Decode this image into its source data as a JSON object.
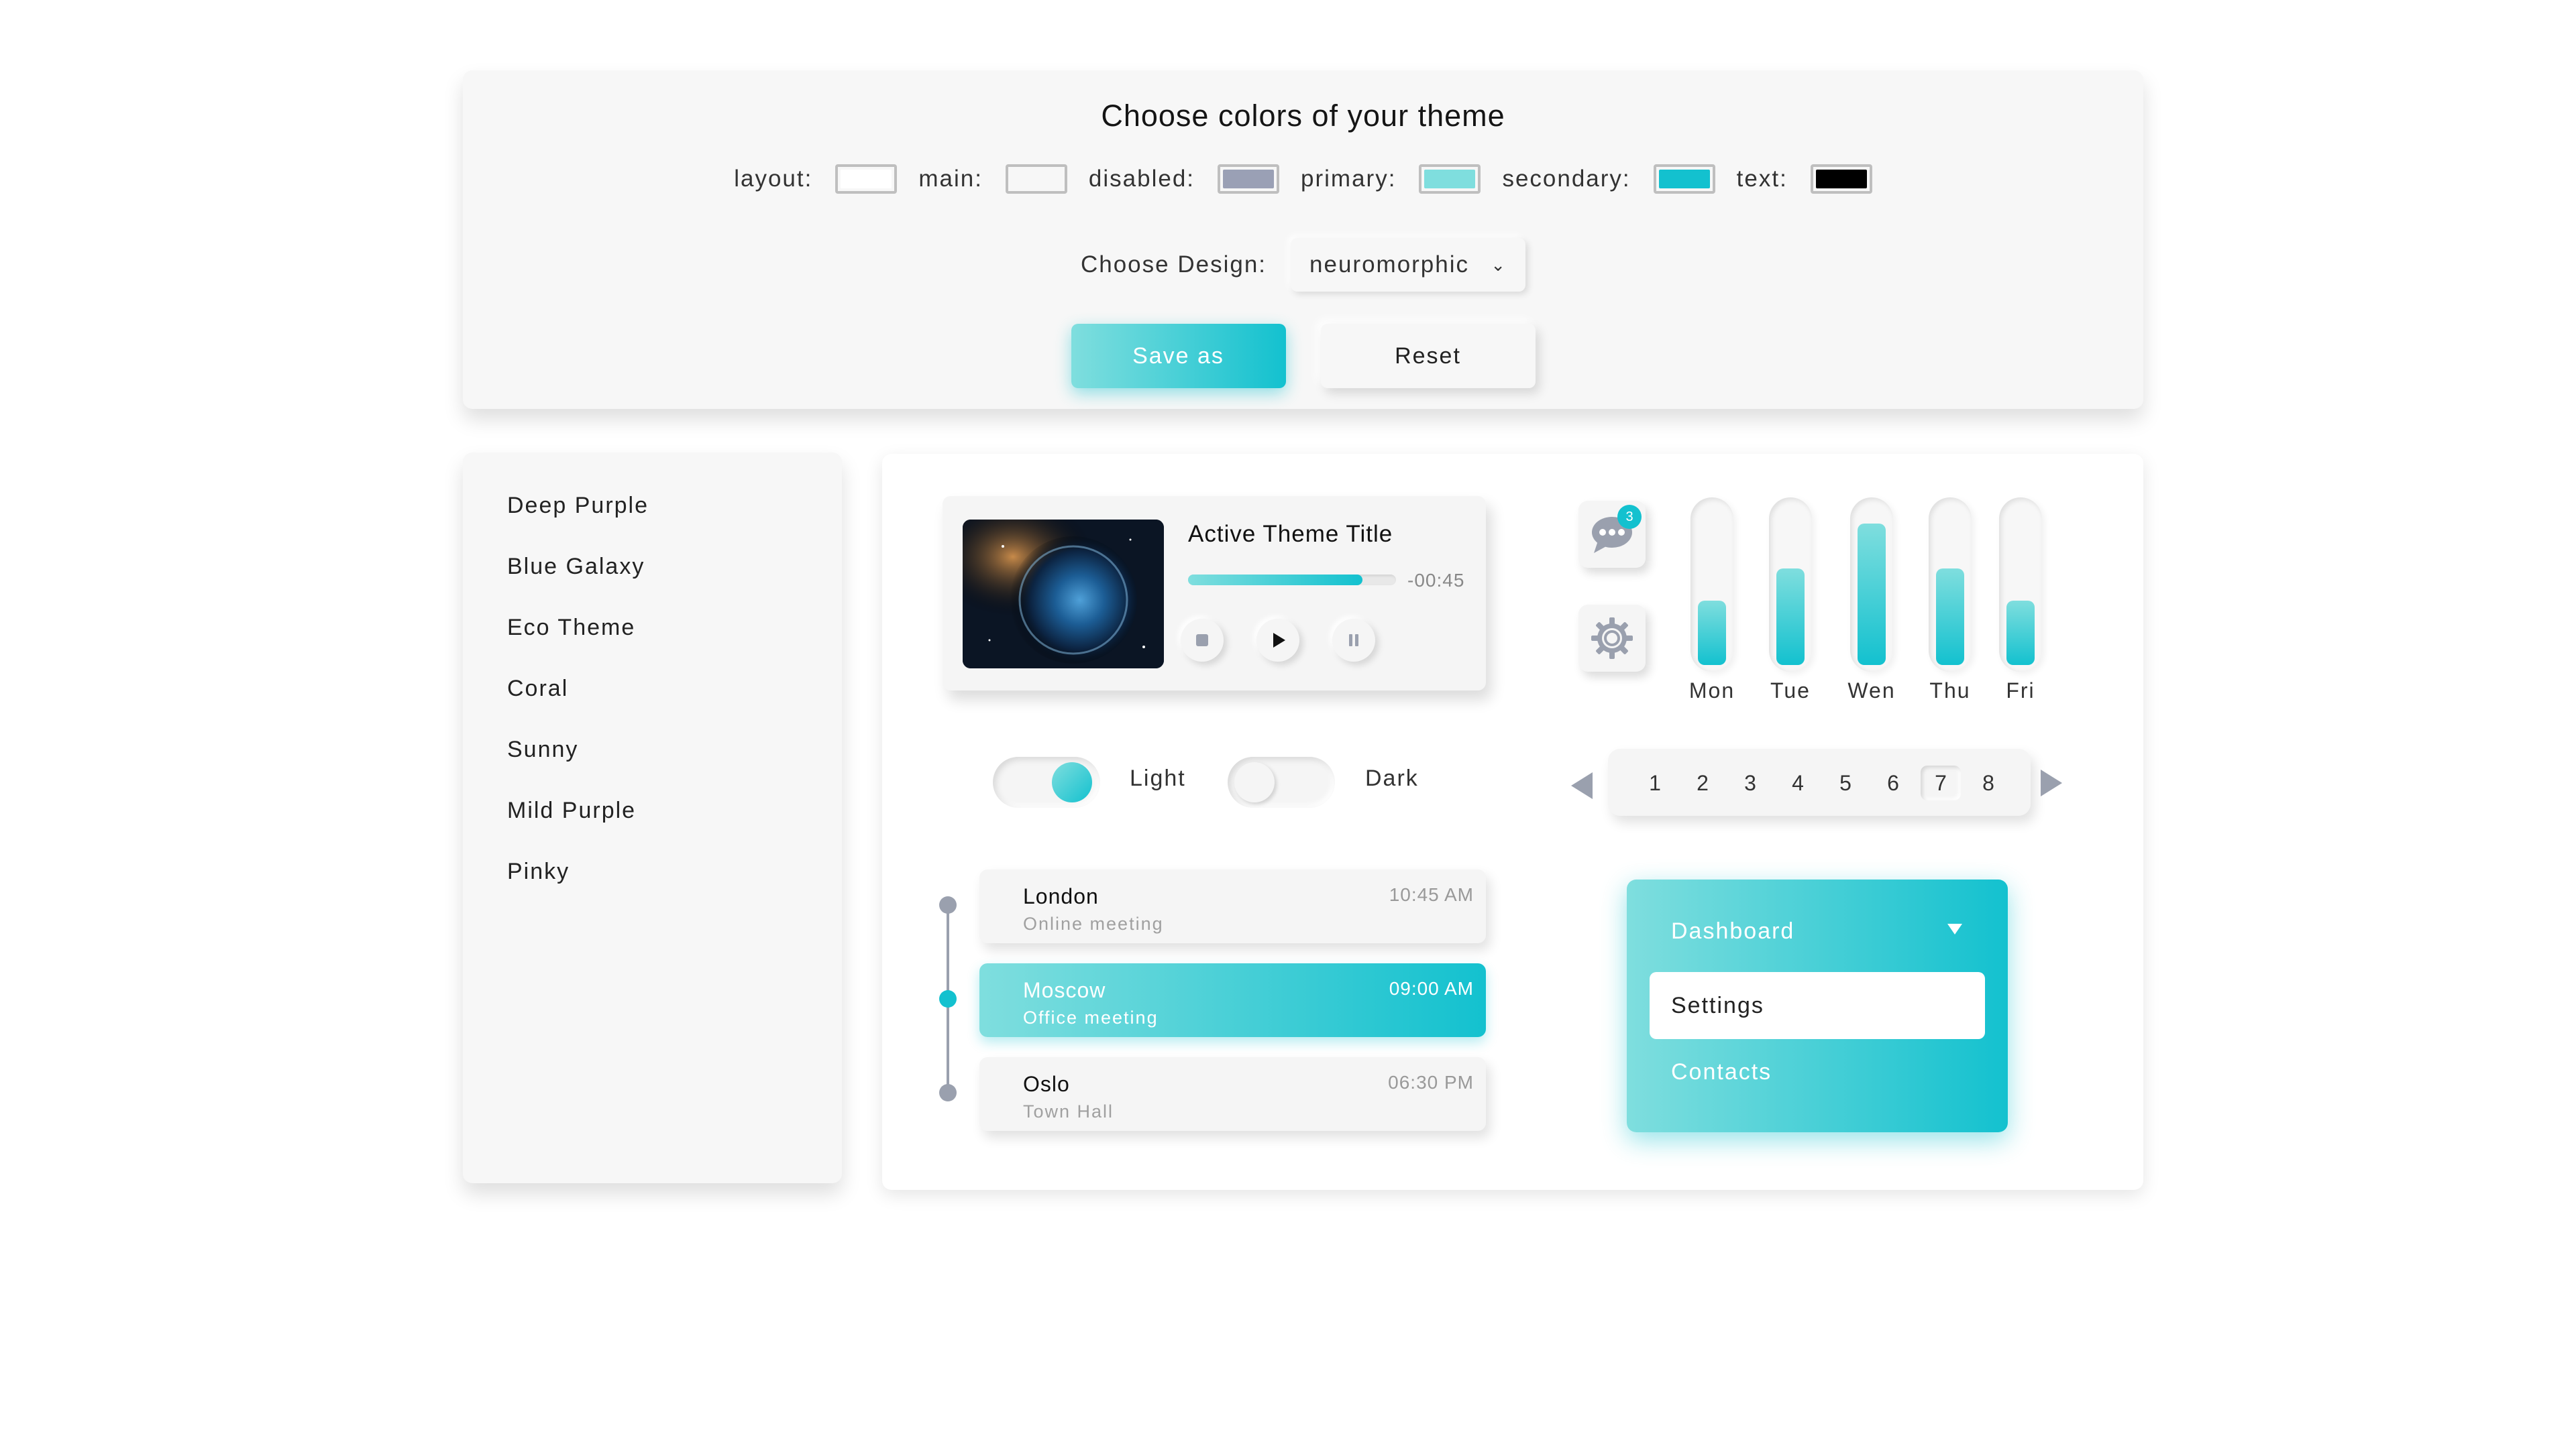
{
  "theme_panel": {
    "title": "Choose colors of your theme",
    "swatches": [
      {
        "label": "layout:",
        "color": "#ffffff"
      },
      {
        "label": "main:",
        "color": "#f7f7f7"
      },
      {
        "label": "disabled:",
        "color": "#9aa0b5"
      },
      {
        "label": "primary:",
        "color": "#7fdede"
      },
      {
        "label": "secondary:",
        "color": "#13c1cf"
      },
      {
        "label": "text:",
        "color": "#000000"
      }
    ],
    "design_label": "Choose Design:",
    "design_value": "neuromorphic",
    "save_label": "Save as",
    "reset_label": "Reset"
  },
  "theme_list": [
    "Deep Purple",
    "Blue Galaxy",
    "Eco Theme",
    "Coral",
    "Sunny",
    "Mild Purple",
    "Pinky"
  ],
  "player": {
    "title": "Active Theme Title",
    "time_left": "-00:45",
    "progress": 0.84
  },
  "chat_badge": "3",
  "weekly_bars": [
    {
      "label": "Mon",
      "value": 0.4
    },
    {
      "label": "Tue",
      "value": 0.6
    },
    {
      "label": "Wen",
      "value": 0.88
    },
    {
      "label": "Thu",
      "value": 0.6
    },
    {
      "label": "Fri",
      "value": 0.4
    }
  ],
  "toggles": {
    "light": {
      "label": "Light",
      "on": true
    },
    "dark": {
      "label": "Dark",
      "on": false
    }
  },
  "pagination": {
    "pages": [
      "1",
      "2",
      "3",
      "4",
      "5",
      "6",
      "7",
      "8"
    ],
    "active": "7"
  },
  "timeline": [
    {
      "city": "London",
      "desc": "Online meeting",
      "time": "10:45 AM",
      "active": false
    },
    {
      "city": "Moscow",
      "desc": "Office meeting",
      "time": "09:00 AM",
      "active": true
    },
    {
      "city": "Oslo",
      "desc": "Town Hall",
      "time": "06:30 PM",
      "active": false
    }
  ],
  "menu": {
    "header": "Dashboard",
    "selected": "Settings",
    "other": "Contacts"
  },
  "colors": {
    "accent": "#13c1cf",
    "accent_light": "#7fdede",
    "muted": "#9aa0ae"
  },
  "icons": [
    "stop-icon",
    "play-icon",
    "pause-icon",
    "chat-icon",
    "gear-icon",
    "arrow-left-icon",
    "arrow-right-icon",
    "caret-down-icon"
  ]
}
